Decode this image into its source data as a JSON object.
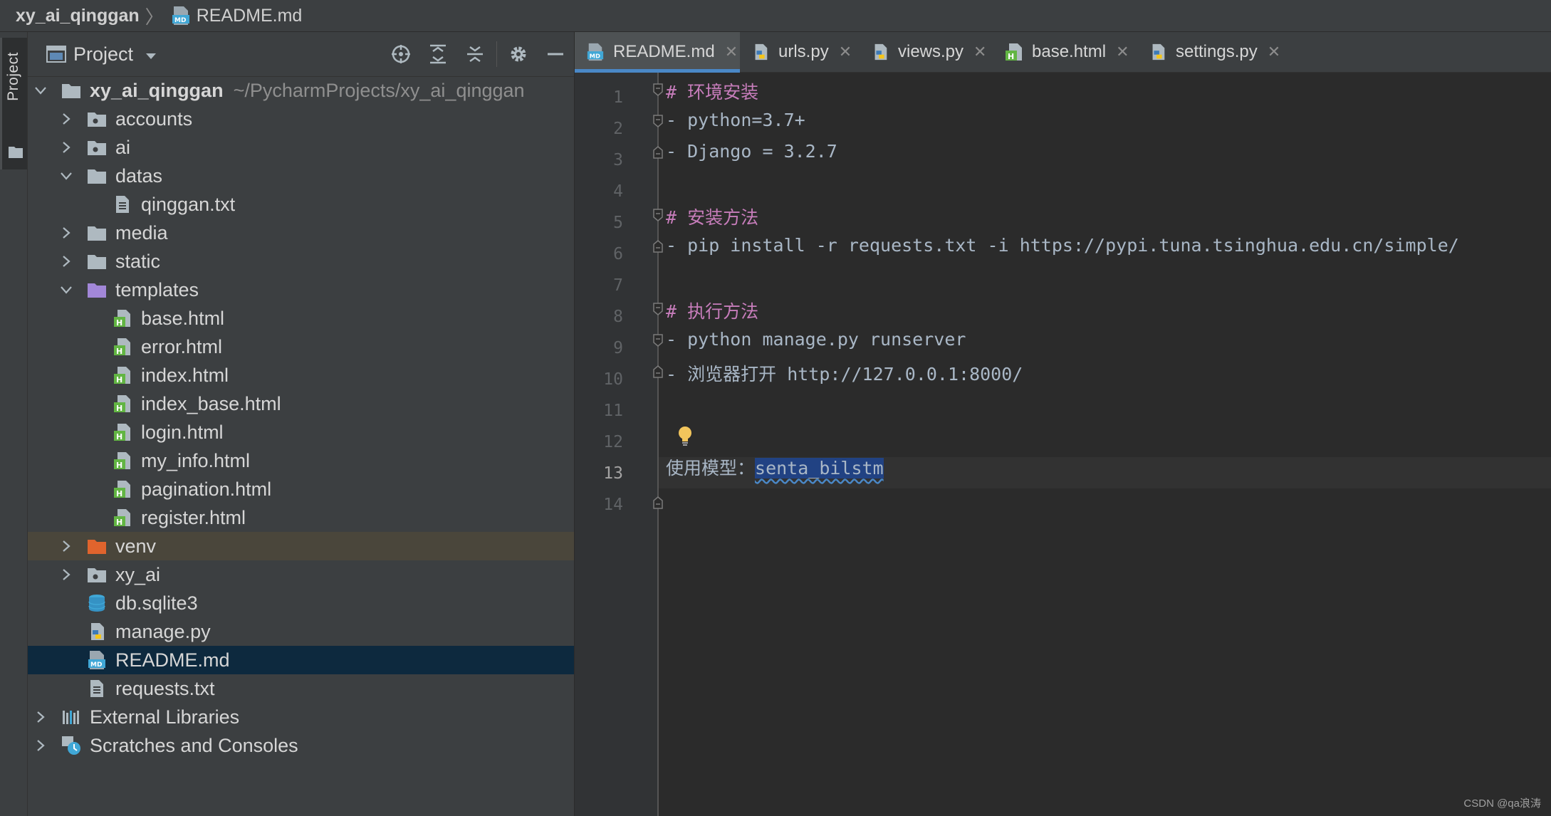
{
  "breadcrumb": {
    "root": "xy_ai_qinggan",
    "file": "README.md"
  },
  "toolwindow_stripe": {
    "label": "Project"
  },
  "project_panel": {
    "title": "Project",
    "tree": [
      {
        "label": "xy_ai_qinggan",
        "path": "~/PycharmProjects/xy_ai_qinggan",
        "icon": "folder-icon",
        "expanded": true
      },
      {
        "label": "accounts",
        "icon": "package-folder-icon"
      },
      {
        "label": "ai",
        "icon": "package-folder-icon"
      },
      {
        "label": "datas",
        "icon": "folder-icon",
        "expanded": true
      },
      {
        "label": "qinggan.txt",
        "icon": "text-file-icon"
      },
      {
        "label": "media",
        "icon": "folder-icon"
      },
      {
        "label": "static",
        "icon": "folder-icon"
      },
      {
        "label": "templates",
        "icon": "templates-folder-icon",
        "expanded": true
      },
      {
        "label": "base.html",
        "icon": "html-file-icon"
      },
      {
        "label": "error.html",
        "icon": "html-file-icon"
      },
      {
        "label": "index.html",
        "icon": "html-file-icon"
      },
      {
        "label": "index_base.html",
        "icon": "html-file-icon"
      },
      {
        "label": "login.html",
        "icon": "html-file-icon"
      },
      {
        "label": "my_info.html",
        "icon": "html-file-icon"
      },
      {
        "label": "pagination.html",
        "icon": "html-file-icon"
      },
      {
        "label": "register.html",
        "icon": "html-file-icon"
      },
      {
        "label": "venv",
        "icon": "excluded-folder-icon"
      },
      {
        "label": "xy_ai",
        "icon": "package-folder-icon"
      },
      {
        "label": "db.sqlite3",
        "icon": "database-icon"
      },
      {
        "label": "manage.py",
        "icon": "python-file-icon"
      },
      {
        "label": "README.md",
        "icon": "markdown-file-icon",
        "selected": true
      },
      {
        "label": "requests.txt",
        "icon": "text-file-icon"
      },
      {
        "label": "External Libraries",
        "icon": "library-icon"
      },
      {
        "label": "Scratches and Consoles",
        "icon": "scratches-icon"
      }
    ]
  },
  "tabs": [
    {
      "label": "README.md",
      "icon": "markdown-file-icon",
      "active": true
    },
    {
      "label": "urls.py",
      "icon": "python-file-icon"
    },
    {
      "label": "views.py",
      "icon": "python-file-icon"
    },
    {
      "label": "base.html",
      "icon": "html-file-icon"
    },
    {
      "label": "settings.py",
      "icon": "python-file-icon"
    }
  ],
  "editor": {
    "line_numbers": [
      "1",
      "2",
      "3",
      "4",
      "5",
      "6",
      "7",
      "8",
      "9",
      "10",
      "11",
      "12",
      "13",
      "14"
    ],
    "current_line": "13",
    "lines": {
      "l1_hash": "#",
      "l1_text": "环境安装",
      "l2": "- python=3.7+",
      "l3": "- Django = 3.2.7",
      "l5_hash": "#",
      "l5_text": "安装方法",
      "l6": "- pip install -r requests.txt -i https://pypi.tuna.tsinghua.edu.cn/simple/",
      "l8_hash": "#",
      "l8_text": "执行方法",
      "l9": "- python manage.py runserver",
      "l10_dash": "-",
      "l10_cn": "浏览器打开",
      "l10_url": "http://127.0.0.1:8000/",
      "l13_prefix": "使用模型：",
      "l13_selected": "senta_bilstm"
    }
  },
  "colors": {
    "background": "#2b2b2b",
    "panel": "#3c3f41",
    "selection_row": "#0d293e",
    "venv_row": "#4a463b",
    "heading": "#c77dbb",
    "code": "#a9b7c6",
    "tab_underline": "#4a88c7"
  },
  "watermark": "CSDN @qa浪涛"
}
